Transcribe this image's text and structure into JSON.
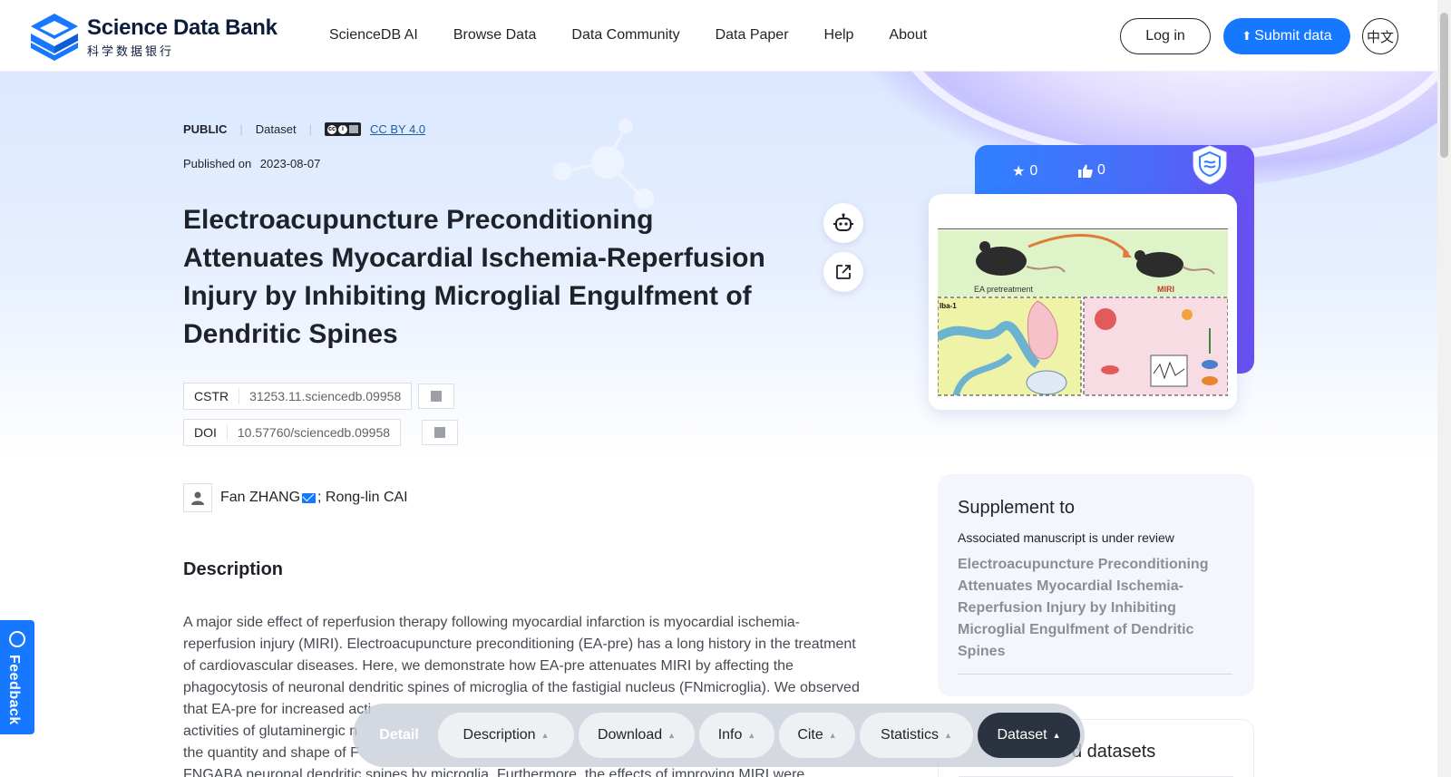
{
  "header": {
    "logo_en": "Science Data Bank",
    "logo_cn": "科学数据银行",
    "nav": [
      "ScienceDB AI",
      "Browse Data",
      "Data Community",
      "Data Paper",
      "Help",
      "About"
    ],
    "login": "Log in",
    "submit": "Submit data",
    "lang": "中文"
  },
  "meta": {
    "visibility": "PUBLIC",
    "type": "Dataset",
    "license": "CC BY 4.0",
    "published_label": "Published on",
    "published_date": "2023-08-07"
  },
  "title": "Electroacupuncture Preconditioning Attenuates Myocardial Ischemia-Reperfusion Injury by Inhibiting Microglial Engulfment of Dendritic Spines",
  "identifiers": {
    "cstr_label": "CSTR",
    "cstr_value": "31253.11.sciencedb.09958",
    "doi_label": "DOI",
    "doi_value": "10.57760/sciencedb.09958"
  },
  "authors": {
    "first": "Fan ZHANG",
    "rest": "; Rong-lin CAI"
  },
  "description": {
    "heading": "Description",
    "lines": [
      "A major side effect of reperfusion therapy following myocardial infarction is myocardial ischemia-",
      "reperfusion injury (MIRI). Electroacupuncture preconditioning (EA-pre) has a long history in the treatment",
      "of cardiovascular diseases. Here, we demonstrate how EA-pre attenuates MIRI by affecting the",
      "phagocytosis of neuronal dendritic spines of microglia of the fastigial nucleus (FNmicroglia). We observed",
      "that EA-pre for increased acti",
      "activities of glutaminergic n",
      "the quantity and shape of F",
      "FNGABA neuronal dendritic spines by microglia. Furthermore, the effects of improving MIRI were"
    ]
  },
  "stats": {
    "stars": "0",
    "likes": "0"
  },
  "figure_labels": {
    "ea": "EA pretreatment",
    "miri": "MIRI",
    "iba": "Iba-1"
  },
  "supplement": {
    "heading": "Supplement to",
    "status": "Associated manuscript is under review",
    "paper_title": "Electroacupuncture Preconditioning Attenuates Myocardial Ischemia-Reperfusion Injury by Inhibiting Microglial Engulfment of Dendritic Spines"
  },
  "related": {
    "title_fragment": "d datasets"
  },
  "feedback": "Feedback",
  "bottom_bar": {
    "detail": "Detail",
    "items": [
      "Description",
      "Download",
      "Info",
      "Cite",
      "Statistics"
    ],
    "active": "Dataset"
  }
}
